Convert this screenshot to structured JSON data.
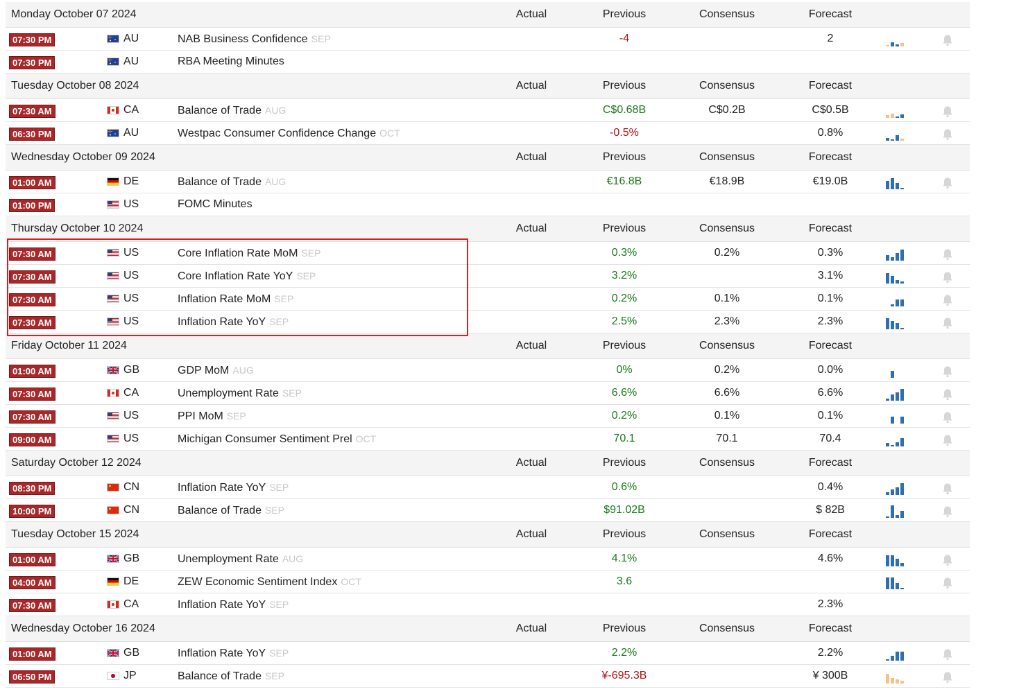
{
  "headers": {
    "actual": "Actual",
    "previous": "Previous",
    "consensus": "Consensus",
    "forecast": "Forecast"
  },
  "colors": {
    "time_bg": "#a8282a",
    "positive": "#1a7a1a",
    "negative": "#b01010",
    "neutral": "#222222",
    "highlight": "#e01b1b",
    "spark_blue": "#2f6fb0",
    "spark_orange": "#f5c28a"
  },
  "days": [
    {
      "date": "Monday October 07 2024",
      "events": [
        {
          "time": "07:30 PM",
          "flag": "au-flag-icon",
          "country": "AU",
          "event": "NAB Business Confidence",
          "ref": "SEP",
          "previous": "-4",
          "previous_color": "negative",
          "consensus": "",
          "forecast": "2",
          "spark": [
            {
              "h": 2,
              "c": "o"
            },
            {
              "h": 6,
              "c": "b"
            },
            {
              "h": 3,
              "c": "b"
            },
            {
              "h": 5,
              "c": "o"
            }
          ],
          "bell": true
        },
        {
          "time": "07:30 PM",
          "flag": "au-flag-icon",
          "country": "AU",
          "event": "RBA Meeting Minutes",
          "ref": "",
          "previous": "",
          "previous_color": "neutral",
          "consensus": "",
          "forecast": "",
          "spark": [],
          "bell": false
        }
      ]
    },
    {
      "date": "Tuesday October 08 2024",
      "events": [
        {
          "time": "07:30 AM",
          "flag": "ca-flag-icon",
          "country": "CA",
          "event": "Balance of Trade",
          "ref": "AUG",
          "previous": "C$0.68B",
          "previous_color": "positive",
          "consensus": "C$0.2B",
          "forecast": "C$0.5B",
          "spark": [
            {
              "h": 4,
              "c": "o"
            },
            {
              "h": 6,
              "c": "o"
            },
            {
              "h": 2,
              "c": "b"
            },
            {
              "h": 5,
              "c": "b"
            }
          ],
          "bell": true
        },
        {
          "time": "06:30 PM",
          "flag": "au-flag-icon",
          "country": "AU",
          "event": "Westpac Consumer Confidence Change",
          "ref": "OCT",
          "previous": "-0.5%",
          "previous_color": "negative",
          "consensus": "",
          "forecast": "0.8%",
          "spark": [
            {
              "h": 4,
              "c": "b"
            },
            {
              "h": 2,
              "c": "b"
            },
            {
              "h": 8,
              "c": "b"
            },
            {
              "h": 3,
              "c": "o"
            }
          ],
          "bell": true
        }
      ]
    },
    {
      "date": "Wednesday October 09 2024",
      "events": [
        {
          "time": "01:00 AM",
          "flag": "de-flag-icon",
          "country": "DE",
          "event": "Balance of Trade",
          "ref": "AUG",
          "previous": "€16.8B",
          "previous_color": "positive",
          "consensus": "€18.9B",
          "forecast": "€19.0B",
          "spark": [
            {
              "h": 12,
              "c": "b"
            },
            {
              "h": 16,
              "c": "b"
            },
            {
              "h": 9,
              "c": "b"
            },
            {
              "h": 2,
              "c": "b"
            }
          ],
          "bell": true
        },
        {
          "time": "01:00 PM",
          "flag": "us-flag-icon",
          "country": "US",
          "event": "FOMC Minutes",
          "ref": "",
          "previous": "",
          "previous_color": "neutral",
          "consensus": "",
          "forecast": "",
          "spark": [],
          "bell": false
        }
      ]
    },
    {
      "date": "Thursday October 10 2024",
      "events": [
        {
          "time": "07:30 AM",
          "flag": "us-flag-icon",
          "country": "US",
          "event": "Core Inflation Rate MoM",
          "ref": "SEP",
          "previous": "0.3%",
          "previous_color": "positive",
          "consensus": "0.2%",
          "forecast": "0.3%",
          "spark": [
            {
              "h": 8,
              "c": "b"
            },
            {
              "h": 5,
              "c": "b"
            },
            {
              "h": 11,
              "c": "b"
            },
            {
              "h": 16,
              "c": "b"
            }
          ],
          "bell": true
        },
        {
          "time": "07:30 AM",
          "flag": "us-flag-icon",
          "country": "US",
          "event": "Core Inflation Rate YoY",
          "ref": "SEP",
          "previous": "3.2%",
          "previous_color": "positive",
          "consensus": "",
          "forecast": "3.1%",
          "spark": [
            {
              "h": 15,
              "c": "b"
            },
            {
              "h": 11,
              "c": "b"
            },
            {
              "h": 5,
              "c": "b"
            },
            {
              "h": 3,
              "c": "b"
            }
          ],
          "bell": true
        },
        {
          "time": "07:30 AM",
          "flag": "us-flag-icon",
          "country": "US",
          "event": "Inflation Rate MoM",
          "ref": "SEP",
          "previous": "0.2%",
          "previous_color": "positive",
          "consensus": "0.1%",
          "forecast": "0.1%",
          "spark": [
            {
              "h": 0,
              "c": "b"
            },
            {
              "h": 3,
              "c": "b"
            },
            {
              "h": 10,
              "c": "b"
            },
            {
              "h": 10,
              "c": "b"
            }
          ],
          "bell": true
        },
        {
          "time": "07:30 AM",
          "flag": "us-flag-icon",
          "country": "US",
          "event": "Inflation Rate YoY",
          "ref": "SEP",
          "previous": "2.5%",
          "previous_color": "positive",
          "consensus": "2.3%",
          "forecast": "2.3%",
          "spark": [
            {
              "h": 16,
              "c": "b"
            },
            {
              "h": 12,
              "c": "b"
            },
            {
              "h": 9,
              "c": "b"
            },
            {
              "h": 2,
              "c": "b"
            }
          ],
          "bell": true
        }
      ]
    },
    {
      "date": "Friday October 11 2024",
      "events": [
        {
          "time": "01:00 AM",
          "flag": "gb-flag-icon",
          "country": "GB",
          "event": "GDP MoM",
          "ref": "AUG",
          "previous": "0%",
          "previous_color": "positive",
          "consensus": "0.2%",
          "forecast": "0.0%",
          "spark": [
            {
              "h": 0,
              "c": "b"
            },
            {
              "h": 10,
              "c": "b"
            },
            {
              "h": 0,
              "c": "b"
            },
            {
              "h": 0,
              "c": "b"
            }
          ],
          "bell": true
        },
        {
          "time": "07:30 AM",
          "flag": "ca-flag-icon",
          "country": "CA",
          "event": "Unemployment Rate",
          "ref": "SEP",
          "previous": "6.6%",
          "previous_color": "positive",
          "consensus": "6.6%",
          "forecast": "6.6%",
          "spark": [
            {
              "h": 3,
              "c": "b"
            },
            {
              "h": 9,
              "c": "b"
            },
            {
              "h": 12,
              "c": "b"
            },
            {
              "h": 17,
              "c": "b"
            }
          ],
          "bell": true
        },
        {
          "time": "07:30 AM",
          "flag": "us-flag-icon",
          "country": "US",
          "event": "PPI MoM",
          "ref": "SEP",
          "previous": "0.2%",
          "previous_color": "positive",
          "consensus": "0.1%",
          "forecast": "0.1%",
          "spark": [
            {
              "h": 0,
              "c": "b"
            },
            {
              "h": 10,
              "c": "b"
            },
            {
              "h": 0,
              "c": "b"
            },
            {
              "h": 10,
              "c": "b"
            }
          ],
          "bell": true
        },
        {
          "time": "09:00 AM",
          "flag": "us-flag-icon",
          "country": "US",
          "event": "Michigan Consumer Sentiment Prel",
          "ref": "OCT",
          "previous": "70.1",
          "previous_color": "positive",
          "consensus": "70.1",
          "forecast": "70.4",
          "spark": [
            {
              "h": 5,
              "c": "b"
            },
            {
              "h": 2,
              "c": "b"
            },
            {
              "h": 6,
              "c": "b"
            },
            {
              "h": 12,
              "c": "b"
            }
          ],
          "bell": true
        }
      ]
    },
    {
      "date": "Saturday October 12 2024",
      "events": [
        {
          "time": "08:30 PM",
          "flag": "cn-flag-icon",
          "country": "CN",
          "event": "Inflation Rate YoY",
          "ref": "SEP",
          "previous": "0.6%",
          "previous_color": "positive",
          "consensus": "",
          "forecast": "0.4%",
          "spark": [
            {
              "h": 4,
              "c": "b"
            },
            {
              "h": 8,
              "c": "b"
            },
            {
              "h": 11,
              "c": "b"
            },
            {
              "h": 17,
              "c": "b"
            }
          ],
          "bell": true
        },
        {
          "time": "10:00 PM",
          "flag": "cn-flag-icon",
          "country": "CN",
          "event": "Balance of Trade",
          "ref": "SEP",
          "previous": "$91.02B",
          "previous_color": "positive",
          "consensus": "",
          "forecast": "$ 82B",
          "spark": [
            {
              "h": 2,
              "c": "b"
            },
            {
              "h": 18,
              "c": "b"
            },
            {
              "h": 4,
              "c": "b"
            },
            {
              "h": 10,
              "c": "b"
            }
          ],
          "bell": true
        }
      ]
    },
    {
      "date": "Tuesday October 15 2024",
      "events": [
        {
          "time": "01:00 AM",
          "flag": "gb-flag-icon",
          "country": "GB",
          "event": "Unemployment Rate",
          "ref": "AUG",
          "previous": "4.1%",
          "previous_color": "positive",
          "consensus": "",
          "forecast": "4.6%",
          "spark": [
            {
              "h": 16,
              "c": "b"
            },
            {
              "h": 16,
              "c": "b"
            },
            {
              "h": 11,
              "c": "b"
            },
            {
              "h": 5,
              "c": "b"
            }
          ],
          "bell": true
        },
        {
          "time": "04:00 AM",
          "flag": "de-flag-icon",
          "country": "DE",
          "event": "ZEW Economic Sentiment Index",
          "ref": "OCT",
          "previous": "3.6",
          "previous_color": "positive",
          "consensus": "",
          "forecast": "",
          "spark": [
            {
              "h": 17,
              "c": "b"
            },
            {
              "h": 17,
              "c": "b"
            },
            {
              "h": 9,
              "c": "b"
            },
            {
              "h": 2,
              "c": "b"
            }
          ],
          "bell": true
        },
        {
          "time": "07:30 AM",
          "flag": "ca-flag-icon",
          "country": "CA",
          "event": "Inflation Rate YoY",
          "ref": "SEP",
          "previous": "",
          "previous_color": "neutral",
          "consensus": "",
          "forecast": "2.3%",
          "spark": [],
          "bell": false
        }
      ]
    },
    {
      "date": "Wednesday October 16 2024",
      "events": [
        {
          "time": "01:00 AM",
          "flag": "gb-flag-icon",
          "country": "GB",
          "event": "Inflation Rate YoY",
          "ref": "SEP",
          "previous": "2.2%",
          "previous_color": "positive",
          "consensus": "",
          "forecast": "2.2%",
          "spark": [
            {
              "h": 2,
              "c": "b"
            },
            {
              "h": 7,
              "c": "b"
            },
            {
              "h": 13,
              "c": "b"
            },
            {
              "h": 13,
              "c": "b"
            }
          ],
          "bell": true
        },
        {
          "time": "06:50 PM",
          "flag": "jp-flag-icon",
          "country": "JP",
          "event": "Balance of Trade",
          "ref": "SEP",
          "previous": "¥-695.3B",
          "previous_color": "negative",
          "consensus": "",
          "forecast": "¥ 300B",
          "spark": [
            {
              "h": 14,
              "c": "o"
            },
            {
              "h": 8,
              "c": "o"
            },
            {
              "h": 6,
              "c": "o"
            },
            {
              "h": 4,
              "c": "o"
            }
          ],
          "bell": true
        }
      ]
    }
  ]
}
